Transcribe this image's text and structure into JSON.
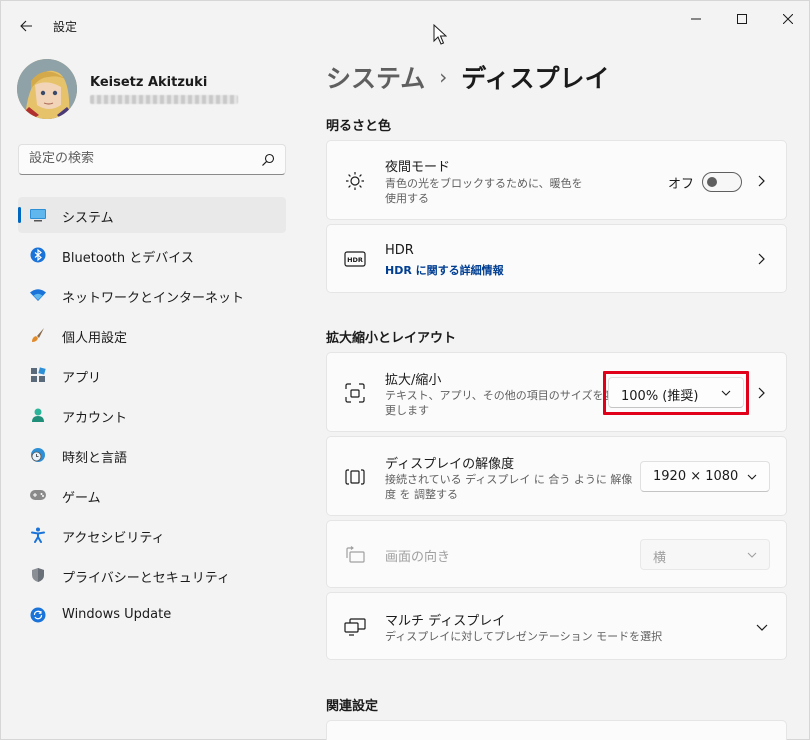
{
  "window": {
    "title": "設定"
  },
  "user": {
    "name": "Keisetz Akitzuki"
  },
  "search": {
    "placeholder": "設定の検索"
  },
  "nav": {
    "items": [
      {
        "label": "システム",
        "icon": "monitor-icon"
      },
      {
        "label": "Bluetooth とデバイス",
        "icon": "bluetooth-icon"
      },
      {
        "label": "ネットワークとインターネット",
        "icon": "wifi-icon"
      },
      {
        "label": "個人用設定",
        "icon": "brush-icon"
      },
      {
        "label": "アプリ",
        "icon": "apps-icon"
      },
      {
        "label": "アカウント",
        "icon": "person-icon"
      },
      {
        "label": "時刻と言語",
        "icon": "clock-globe-icon"
      },
      {
        "label": "ゲーム",
        "icon": "gamepad-icon"
      },
      {
        "label": "アクセシビリティ",
        "icon": "accessibility-icon"
      },
      {
        "label": "プライバシーとセキュリティ",
        "icon": "shield-icon"
      },
      {
        "label": "Windows Update",
        "icon": "sync-icon"
      }
    ]
  },
  "breadcrumb": {
    "parent": "システム",
    "separator": "›",
    "current": "ディスプレイ"
  },
  "sections": {
    "brightness": "明るさと色",
    "scale_layout": "拡大縮小とレイアウト",
    "related": "関連設定"
  },
  "night_light": {
    "title": "夜間モード",
    "desc_line1": "青色の光をブロックするために、暖色を",
    "desc_line2": "使用する",
    "state_label": "オフ"
  },
  "hdr": {
    "title": "HDR",
    "link": "HDR に関する詳細情報"
  },
  "scale": {
    "title": "拡大/縮小",
    "desc_line1": "テキスト、アプリ、その他の項目のサイズを変",
    "desc_line2": "更します",
    "value": "100% (推奨)"
  },
  "resolution": {
    "title": "ディスプレイの解像度",
    "desc_line1": "接続されている ディスプレイ に 合う ように 解像",
    "desc_line2": "度 を 調整する",
    "value": "1920 × 1080"
  },
  "orientation": {
    "title": "画面の向き",
    "value": "横"
  },
  "multi_display": {
    "title": "マルチ ディスプレイ",
    "desc": "ディスプレイに対してプレゼンテーション モードを選択"
  },
  "colors": {
    "accent": "#0067c0",
    "highlight": "#e0001a",
    "link": "#003e92"
  }
}
